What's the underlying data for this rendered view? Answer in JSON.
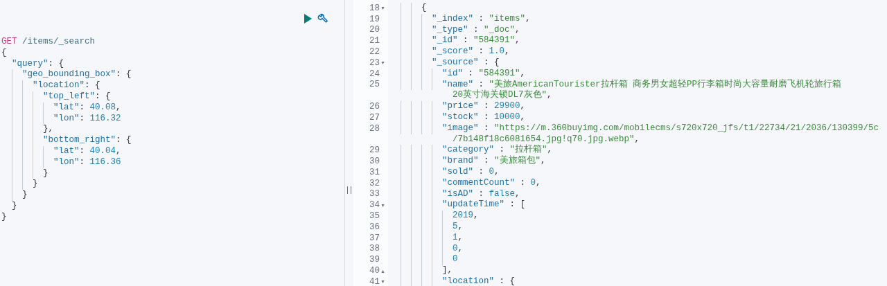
{
  "request_editor": {
    "toolbar": [
      {
        "kind": "run"
      },
      {
        "kind": "settings"
      }
    ],
    "lines": [
      [
        {
          "kind": "method",
          "text": "GET"
        },
        {
          "kind": "path",
          "text": " /items/_search"
        }
      ],
      [
        {
          "kind": "punct",
          "text": "{"
        }
      ],
      [
        {
          "kind": "key",
          "text": "  \"query\""
        },
        {
          "kind": "punct",
          "text": ": {"
        }
      ],
      [
        {
          "kind": "key",
          "text": "    \"geo_bounding_box\""
        },
        {
          "kind": "punct",
          "text": ": {"
        }
      ],
      [
        {
          "kind": "key",
          "text": "      \"location\""
        },
        {
          "kind": "punct",
          "text": ": {"
        }
      ],
      [
        {
          "kind": "key",
          "text": "        \"top_left\""
        },
        {
          "kind": "punct",
          "text": ": {"
        }
      ],
      [
        {
          "kind": "key",
          "text": "          \"lat\""
        },
        {
          "kind": "punct",
          "text": ": "
        },
        {
          "kind": "number",
          "text": "40.08"
        },
        {
          "kind": "punct",
          "text": ","
        }
      ],
      [
        {
          "kind": "key",
          "text": "          \"lon\""
        },
        {
          "kind": "punct",
          "text": ": "
        },
        {
          "kind": "number",
          "text": "116.32"
        }
      ],
      [
        {
          "kind": "punct",
          "text": "        },"
        }
      ],
      [
        {
          "kind": "key",
          "text": "        \"bottom_right\""
        },
        {
          "kind": "punct",
          "text": ": {"
        }
      ],
      [
        {
          "kind": "key",
          "text": "          \"lat\""
        },
        {
          "kind": "punct",
          "text": ": "
        },
        {
          "kind": "number",
          "text": "40.04"
        },
        {
          "kind": "punct",
          "text": ","
        }
      ],
      [
        {
          "kind": "key",
          "text": "          \"lon\""
        },
        {
          "kind": "punct",
          "text": ": "
        },
        {
          "kind": "number",
          "text": "116.36"
        }
      ],
      [
        {
          "kind": "punct",
          "text": "        }"
        }
      ],
      [
        {
          "kind": "punct",
          "text": "      }"
        }
      ],
      [
        {
          "kind": "punct",
          "text": "    }"
        }
      ],
      [
        {
          "kind": "punct",
          "text": "  }"
        }
      ],
      [
        {
          "kind": "punct",
          "text": "}"
        }
      ]
    ]
  },
  "response_viewer": {
    "lines": [
      {
        "number": "18",
        "fold_marker": "▾",
        "tokens": [
          {
            "kind": "punct",
            "text": "      {"
          }
        ]
      },
      {
        "number": "19",
        "tokens": [
          {
            "kind": "key",
            "text": "        \"_index\""
          },
          {
            "kind": "punct",
            "text": " : "
          },
          {
            "kind": "string",
            "text": "\"items\""
          },
          {
            "kind": "punct",
            "text": ","
          }
        ]
      },
      {
        "number": "20",
        "tokens": [
          {
            "kind": "key",
            "text": "        \"_type\""
          },
          {
            "kind": "punct",
            "text": " : "
          },
          {
            "kind": "string",
            "text": "\"_doc\""
          },
          {
            "kind": "punct",
            "text": ","
          }
        ]
      },
      {
        "number": "21",
        "tokens": [
          {
            "kind": "key",
            "text": "        \"_id\""
          },
          {
            "kind": "punct",
            "text": " : "
          },
          {
            "kind": "string",
            "text": "\"584391\""
          },
          {
            "kind": "punct",
            "text": ","
          }
        ]
      },
      {
        "number": "22",
        "tokens": [
          {
            "kind": "key",
            "text": "        \"_score\""
          },
          {
            "kind": "punct",
            "text": " : "
          },
          {
            "kind": "number",
            "text": "1.0"
          },
          {
            "kind": "punct",
            "text": ","
          }
        ]
      },
      {
        "number": "23",
        "fold_marker": "▾",
        "tokens": [
          {
            "kind": "key",
            "text": "        \"_source\""
          },
          {
            "kind": "punct",
            "text": " : {"
          }
        ]
      },
      {
        "number": "24",
        "tokens": [
          {
            "kind": "key",
            "text": "          \"id\""
          },
          {
            "kind": "punct",
            "text": " : "
          },
          {
            "kind": "string",
            "text": "\"584391\""
          },
          {
            "kind": "punct",
            "text": ","
          }
        ]
      },
      {
        "number": "25",
        "tokens": [
          {
            "kind": "key",
            "text": "          \"name\""
          },
          {
            "kind": "punct",
            "text": " : "
          },
          {
            "kind": "string",
            "text": "\"美旅AmericanTourister拉杆箱 商务男女超轻PP行李箱时尚大容量耐磨飞机轮旅行箱"
          }
        ],
        "wrapped_tokens": [
          {
            "kind": "string",
            "text": "20英寸海关锁DL7灰色\""
          },
          {
            "kind": "punct",
            "text": ","
          }
        ]
      },
      {
        "number": "26",
        "tokens": [
          {
            "kind": "key",
            "text": "          \"price\""
          },
          {
            "kind": "punct",
            "text": " : "
          },
          {
            "kind": "number",
            "text": "29900"
          },
          {
            "kind": "punct",
            "text": ","
          }
        ]
      },
      {
        "number": "27",
        "tokens": [
          {
            "kind": "key",
            "text": "          \"stock\""
          },
          {
            "kind": "punct",
            "text": " : "
          },
          {
            "kind": "number",
            "text": "10000"
          },
          {
            "kind": "punct",
            "text": ","
          }
        ]
      },
      {
        "number": "28",
        "tokens": [
          {
            "kind": "key",
            "text": "          \"image\""
          },
          {
            "kind": "punct",
            "text": " : "
          },
          {
            "kind": "string",
            "text": "\"https://m.360buyimg.com/mobilecms/s720x720_jfs/t1/22734/21/2036/130399/5c"
          }
        ],
        "wrapped_tokens": [
          {
            "kind": "string",
            "text": "/7b148f18c6081654.jpg!q70.jpg.webp\""
          },
          {
            "kind": "punct",
            "text": ","
          }
        ]
      },
      {
        "number": "29",
        "tokens": [
          {
            "kind": "key",
            "text": "          \"category\""
          },
          {
            "kind": "punct",
            "text": " : "
          },
          {
            "kind": "string",
            "text": "\"拉杆箱\""
          },
          {
            "kind": "punct",
            "text": ","
          }
        ]
      },
      {
        "number": "30",
        "tokens": [
          {
            "kind": "key",
            "text": "          \"brand\""
          },
          {
            "kind": "punct",
            "text": " : "
          },
          {
            "kind": "string",
            "text": "\"美旅箱包\""
          },
          {
            "kind": "punct",
            "text": ","
          }
        ]
      },
      {
        "number": "31",
        "tokens": [
          {
            "kind": "key",
            "text": "          \"sold\""
          },
          {
            "kind": "punct",
            "text": " : "
          },
          {
            "kind": "number",
            "text": "0"
          },
          {
            "kind": "punct",
            "text": ","
          }
        ]
      },
      {
        "number": "32",
        "tokens": [
          {
            "kind": "key",
            "text": "          \"commentCount\""
          },
          {
            "kind": "punct",
            "text": " : "
          },
          {
            "kind": "number",
            "text": "0"
          },
          {
            "kind": "punct",
            "text": ","
          }
        ]
      },
      {
        "number": "33",
        "tokens": [
          {
            "kind": "key",
            "text": "          \"isAD\""
          },
          {
            "kind": "punct",
            "text": " : "
          },
          {
            "kind": "boolean",
            "text": "false"
          },
          {
            "kind": "punct",
            "text": ","
          }
        ]
      },
      {
        "number": "34",
        "fold_marker": "▾",
        "tokens": [
          {
            "kind": "key",
            "text": "          \"updateTime\""
          },
          {
            "kind": "punct",
            "text": " : ["
          }
        ]
      },
      {
        "number": "35",
        "tokens": [
          {
            "kind": "number",
            "text": "            2019"
          },
          {
            "kind": "punct",
            "text": ","
          }
        ]
      },
      {
        "number": "36",
        "tokens": [
          {
            "kind": "number",
            "text": "            5"
          },
          {
            "kind": "punct",
            "text": ","
          }
        ]
      },
      {
        "number": "37",
        "tokens": [
          {
            "kind": "number",
            "text": "            1"
          },
          {
            "kind": "punct",
            "text": ","
          }
        ]
      },
      {
        "number": "38",
        "tokens": [
          {
            "kind": "number",
            "text": "            0"
          },
          {
            "kind": "punct",
            "text": ","
          }
        ]
      },
      {
        "number": "39",
        "tokens": [
          {
            "kind": "number",
            "text": "            0"
          }
        ]
      },
      {
        "number": "40",
        "fold_marker": "▴",
        "tokens": [
          {
            "kind": "punct",
            "text": "          ],"
          }
        ]
      },
      {
        "number": "41",
        "fold_marker": "▾",
        "tokens": [
          {
            "kind": "key",
            "text": "          \"location\""
          },
          {
            "kind": "punct",
            "text": " : {"
          }
        ]
      }
    ]
  }
}
